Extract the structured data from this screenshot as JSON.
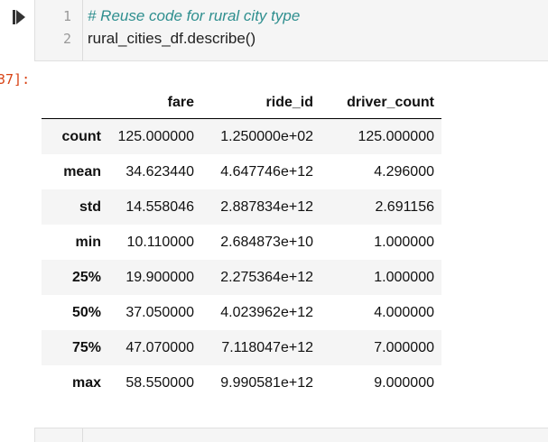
{
  "code_cell": {
    "lines": [
      {
        "number": "1",
        "text": "# Reuse code for rural city type"
      },
      {
        "number": "2",
        "text": "rural_cities_df.describe()"
      }
    ]
  },
  "output_prompt": "37]:",
  "table": {
    "columns": [
      "",
      "fare",
      "ride_id",
      "driver_count"
    ],
    "rows": [
      {
        "index": "count",
        "fare": "125.000000",
        "ride_id": "1.250000e+02",
        "driver_count": "125.000000"
      },
      {
        "index": "mean",
        "fare": "34.623440",
        "ride_id": "4.647746e+12",
        "driver_count": "4.296000"
      },
      {
        "index": "std",
        "fare": "14.558046",
        "ride_id": "2.887834e+12",
        "driver_count": "2.691156"
      },
      {
        "index": "min",
        "fare": "10.110000",
        "ride_id": "2.684873e+10",
        "driver_count": "1.000000"
      },
      {
        "index": "25%",
        "fare": "19.900000",
        "ride_id": "2.275364e+12",
        "driver_count": "1.000000"
      },
      {
        "index": "50%",
        "fare": "37.050000",
        "ride_id": "4.023962e+12",
        "driver_count": "4.000000"
      },
      {
        "index": "75%",
        "fare": "47.070000",
        "ride_id": "7.118047e+12",
        "driver_count": "7.000000"
      },
      {
        "index": "max",
        "fare": "58.550000",
        "ride_id": "9.990581e+12",
        "driver_count": "9.000000"
      }
    ]
  }
}
